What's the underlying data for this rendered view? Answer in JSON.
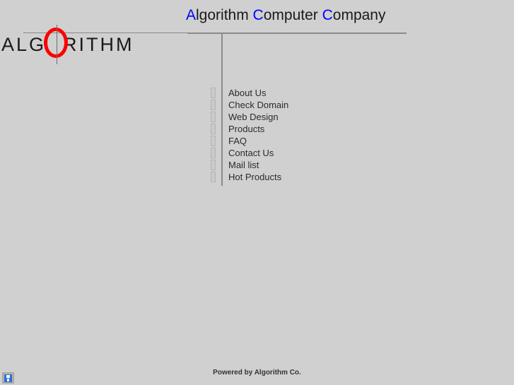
{
  "page": {
    "background_color": "#d0d0d0"
  },
  "header": {
    "title_parts": [
      {
        "cap": "A",
        "rest": "lgorithm "
      },
      {
        "cap": "C",
        "rest": "omputer "
      },
      {
        "cap": "C",
        "rest": "ompany"
      }
    ],
    "title_full": "Algorithm Computer Company",
    "cap_color": "#0000ff",
    "text_color": "#1a1a1a"
  },
  "logo": {
    "text_before": "ALG",
    "text_after": "RITHM",
    "ring_color": "#fb0000",
    "ring_letter": "O",
    "text_color": "#1a1a1a"
  },
  "nav": {
    "items": [
      {
        "label": "About Us"
      },
      {
        "label": "Check Domain"
      },
      {
        "label": "Web Design"
      },
      {
        "label": "Products"
      },
      {
        "label": "FAQ"
      },
      {
        "label": "Contact Us"
      },
      {
        "label": "Mail list"
      },
      {
        "label": "Hot Products"
      }
    ]
  },
  "footer": {
    "credit": "Powered by Algorithm Co."
  },
  "placeholder": {
    "icon": "broken-image-icon"
  }
}
